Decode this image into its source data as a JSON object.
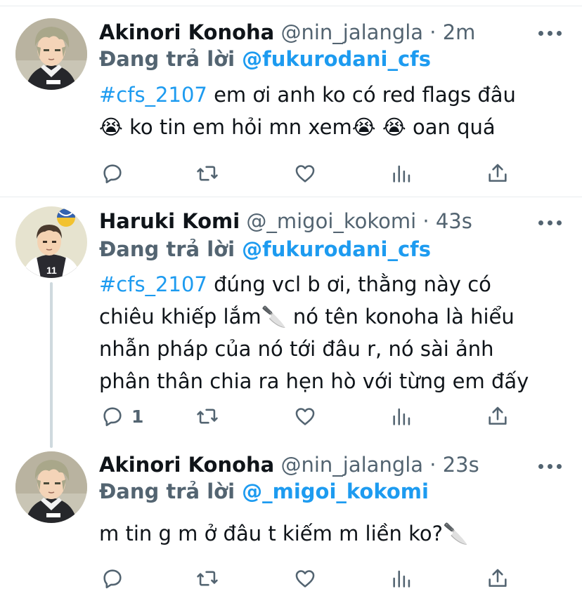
{
  "tweets": [
    {
      "name": "Akinori Konoha",
      "handle": "@nin_jalangla",
      "separator": "·",
      "time": "2m",
      "reply_prefix": "Đang trả lời",
      "reply_to": "@fukurodani_cfs",
      "hashtag": "#cfs_2107",
      "line1": " em ơi anh ko có red flags đâu",
      "line2": "😭  ko tin em hỏi mn xem😭 😭 oan quá",
      "reply_count": ""
    },
    {
      "name": "Haruki Komi",
      "handle": "@_migoi_kokomi",
      "separator": "·",
      "time": "43s",
      "reply_prefix": "Đang trả lời",
      "reply_to": "@fukurodani_cfs",
      "hashtag": "#cfs_2107",
      "line1": " đúng vcl b ơi, thằng này có",
      "line2": "chiêu khiếp lắm🔪  nó tên konoha là hiểu",
      "line3": "nhẫn pháp của nó tới đâu r, nó sài ảnh",
      "line4": "phân thân chia ra hẹn hò với từng em đấy",
      "reply_count": "1"
    },
    {
      "name": "Akinori Konoha",
      "handle": "@nin_jalangla",
      "separator": "·",
      "time": "23s",
      "reply_prefix": "Đang trả lời",
      "reply_to": "@_migoi_kokomi",
      "line1": "m tin g m ở đâu t kiếm m liền ko?🔪",
      "reply_count": ""
    }
  ],
  "icons": {
    "reply": "reply-icon",
    "retweet": "retweet-icon",
    "like": "heart-icon",
    "analytics": "analytics-icon",
    "share": "share-icon",
    "more": "more-icon"
  },
  "colors": {
    "link": "#1d9bf0",
    "secondary": "#536471",
    "text": "#0f1419",
    "divider": "#e8ecef",
    "thread_line": "#cfd9de"
  }
}
